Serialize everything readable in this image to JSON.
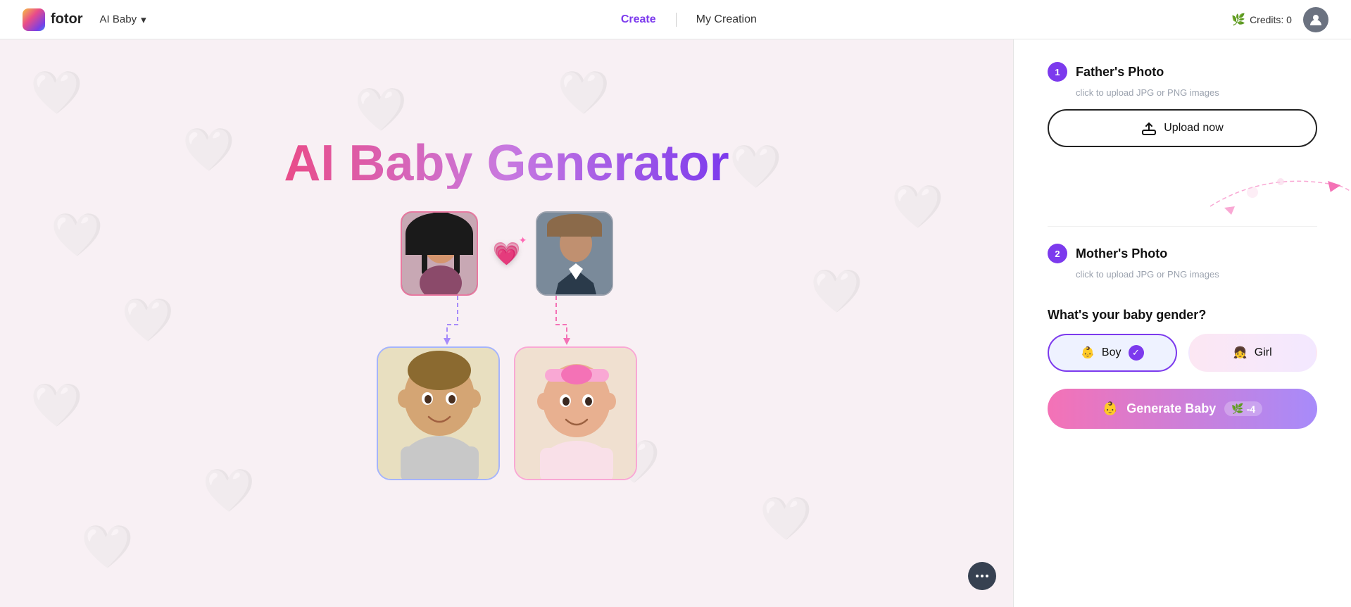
{
  "header": {
    "logo_text": "fotor",
    "ai_baby_label": "AI Baby",
    "nav_create": "Create",
    "nav_my_creation": "My Creation",
    "credits_label": "Credits: 0"
  },
  "canvas": {
    "title": "AI Baby Generator"
  },
  "panel": {
    "step1_number": "1",
    "step1_title": "Father's Photo",
    "step1_subtitle": "click to upload JPG or PNG images",
    "upload_now_label": "Upload now",
    "step2_number": "2",
    "step2_title": "Mother's Photo",
    "step2_subtitle": "click to upload JPG or PNG images",
    "gender_question": "What's your baby gender?",
    "boy_label": "Boy",
    "girl_label": "Girl",
    "generate_label": "Generate Baby",
    "credits_cost": "-4"
  }
}
